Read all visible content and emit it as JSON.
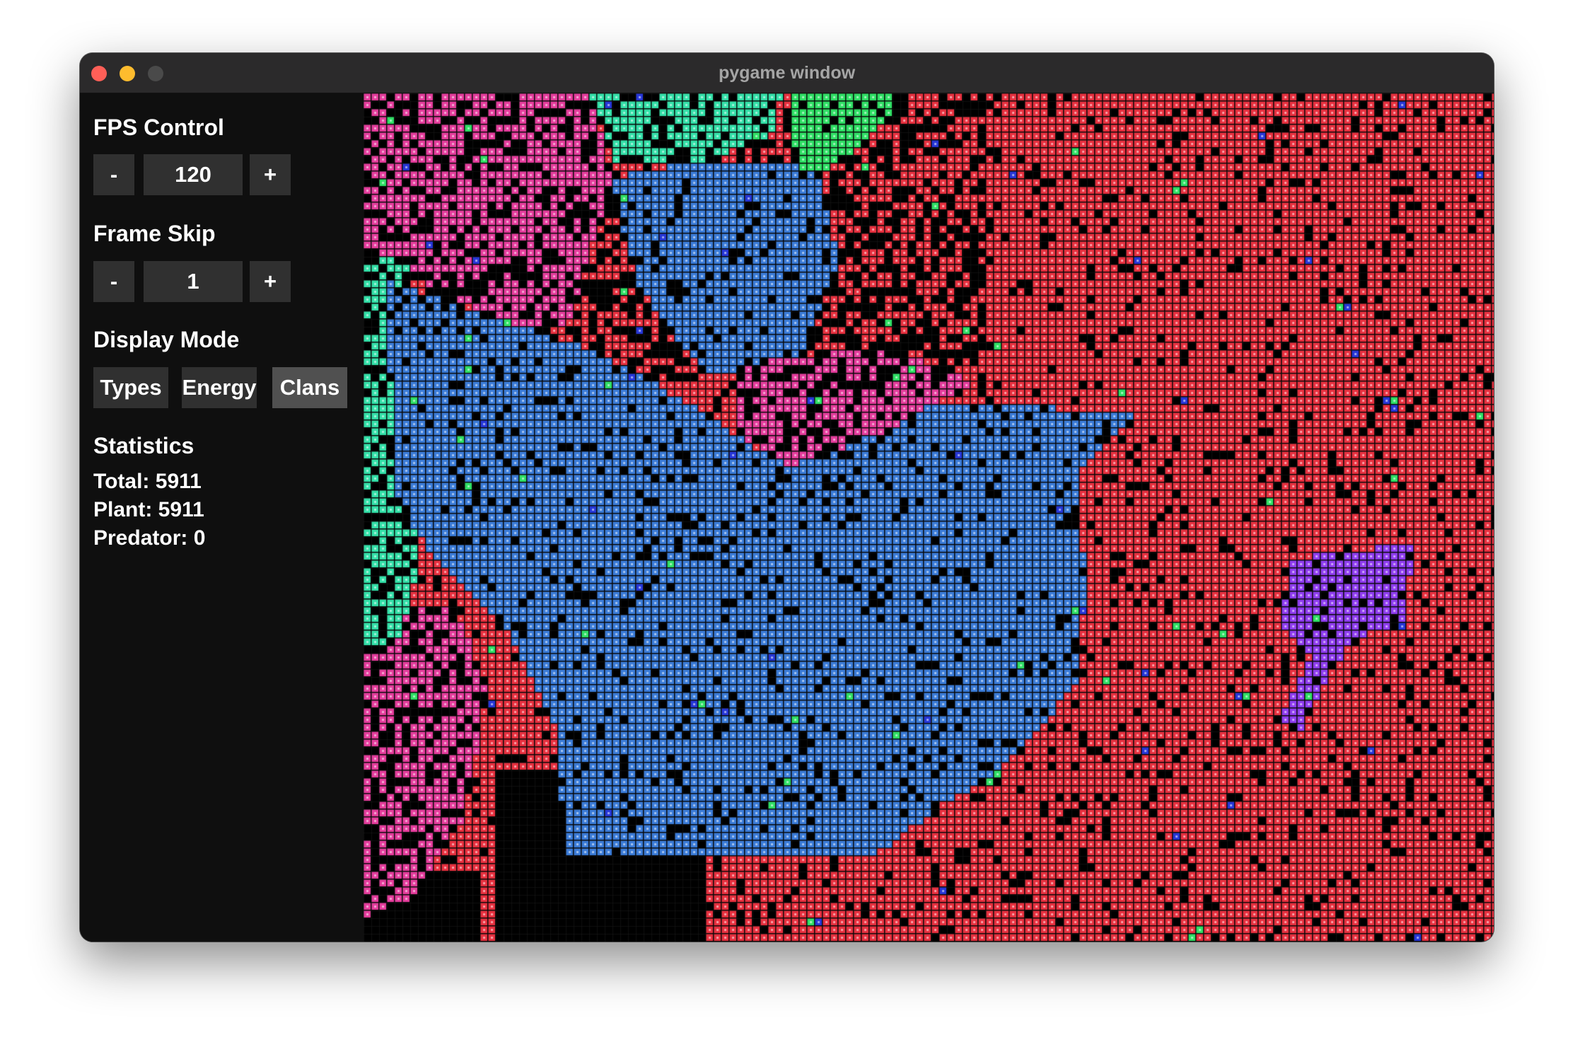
{
  "window": {
    "title": "pygame window"
  },
  "sidebar": {
    "fps_control": {
      "heading": "FPS Control",
      "minus": "-",
      "value": "120",
      "plus": "+"
    },
    "frame_skip": {
      "heading": "Frame Skip",
      "minus": "-",
      "value": "1",
      "plus": "+"
    },
    "display_mode": {
      "heading": "Display Mode",
      "options": [
        "Types",
        "Energy",
        "Clans"
      ],
      "selected": "Clans"
    },
    "statistics": {
      "heading": "Statistics",
      "total": "Total: 5911",
      "plant": "Plant: 5911",
      "predator": "Predator: 0"
    }
  },
  "simulation": {
    "clan_colors": {
      "red": "#e8303f",
      "blue": "#3a7bd8",
      "pink": "#e53c9c",
      "teal": "#33e0a8",
      "green": "#2fe065",
      "purple": "#8f3cf0",
      "navy": "#2636d8",
      "empty": "#000000",
      "gridline": "#1c1c1c"
    }
  }
}
